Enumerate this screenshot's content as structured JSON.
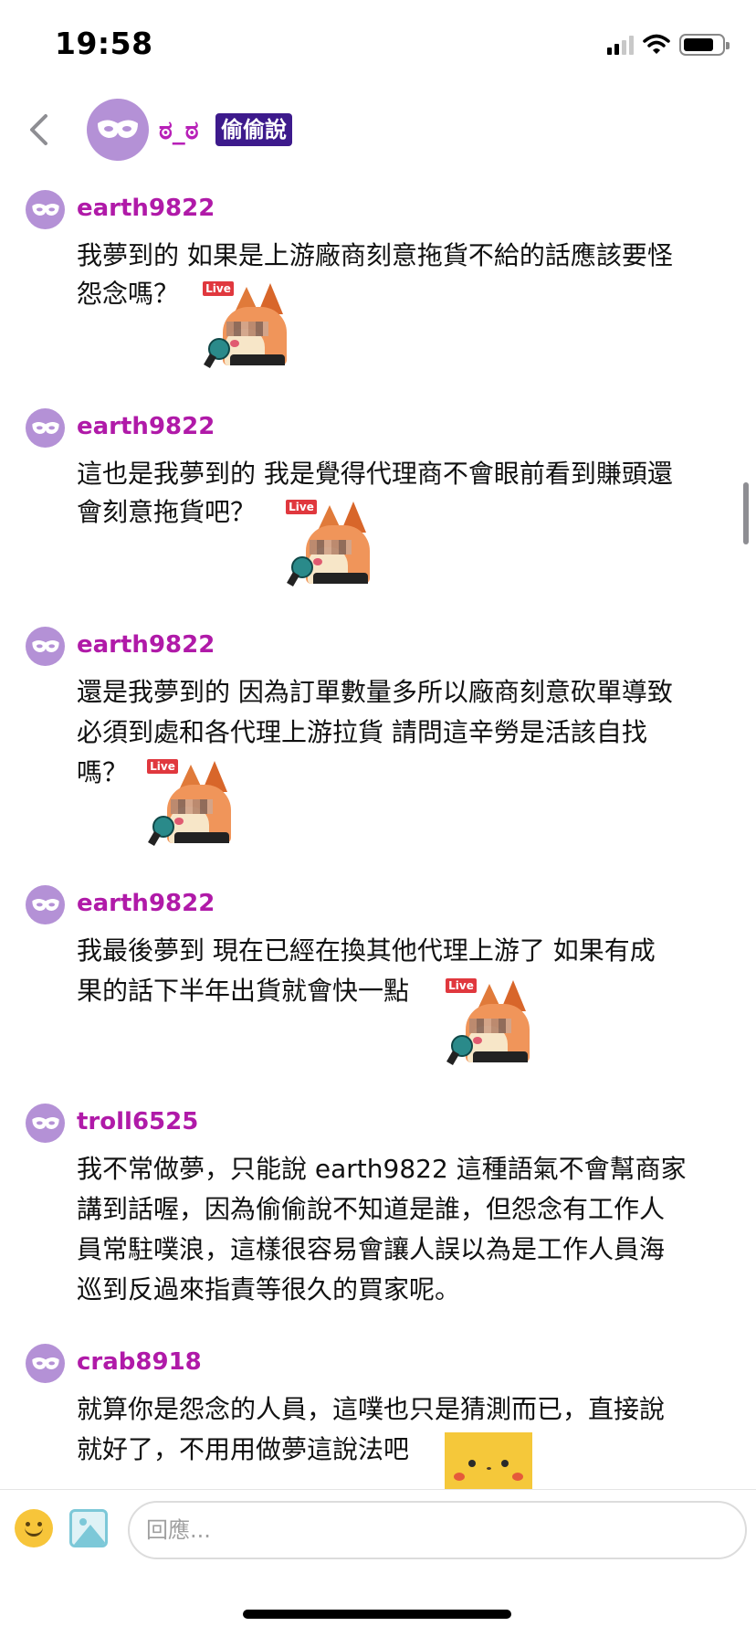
{
  "status": {
    "time": "19:58"
  },
  "header": {
    "name": "ಠ_ಠ",
    "badge": "偷偷說"
  },
  "comments": [
    {
      "user": "earth9822",
      "lines": [
        "我夢到的 如果是上游廠商刻意拖貨不給的話應該要怪",
        "怨念嗎？"
      ]
    },
    {
      "user": "earth9822",
      "lines": [
        "這也是我夢到的 我是覺得代理商不會眼前看到賺頭還",
        "會刻意拖貨吧？"
      ]
    },
    {
      "user": "earth9822",
      "lines": [
        "還是我夢到的 因為訂單數量多所以廠商刻意砍單導致",
        "必須到處和各代理上游拉貨 請問這辛勞是活該自找",
        "嗎？"
      ]
    },
    {
      "user": "earth9822",
      "lines": [
        "我最後夢到 現在已經在換其他代理上游了 如果有成",
        "果的話下半年出貨就會快一點"
      ]
    },
    {
      "user": "troll6525",
      "lines": [
        "我不常做夢，只能說 earth9822 這種語氣不會幫商家",
        "講到話喔，因為偷偷說不知道是誰，但怨念有工作人",
        "員常駐噗浪，這樣很容易會讓人誤以為是工作人員海",
        "巡到反過來指責等很久的買家呢。"
      ]
    },
    {
      "user": "crab8918",
      "lines": [
        "就算你是怨念的人員，這噗也只是猜測而已，直接說",
        "就好了，不用用做夢這說法吧"
      ]
    }
  ],
  "sticker": {
    "live_label": "Live"
  },
  "composer": {
    "placeholder": "回應..."
  },
  "colors": {
    "username": "#b01aa8",
    "avatar": "#b491d6",
    "badge_bg": "#3d1a8c"
  }
}
